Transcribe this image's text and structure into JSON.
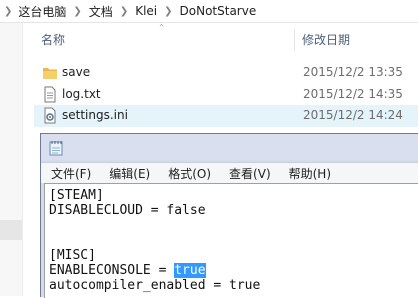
{
  "breadcrumb": {
    "items": [
      "这台电脑",
      "文档",
      "Klei",
      "DoNotStarve"
    ]
  },
  "columns": {
    "name": "名称",
    "date_modified": "修改日期"
  },
  "files": [
    {
      "name": "save",
      "date": "2015/12/2 13:35",
      "icon": "folder-icon"
    },
    {
      "name": "log.txt",
      "date": "2015/12/2 14:35",
      "icon": "text-file-icon"
    },
    {
      "name": "settings.ini",
      "date": "2015/12/2 14:24",
      "icon": "settings-file-icon",
      "selected": true
    }
  ],
  "notepad": {
    "menu": [
      "文件(F)",
      "编辑(E)",
      "格式(O)",
      "查看(V)",
      "帮助(H)"
    ],
    "lines": [
      "[STEAM]",
      "DISABLECLOUD = false",
      "",
      "",
      "[MISC]",
      "ENABLECONSOLE = ",
      "autocompiler_enabled = true"
    ],
    "selected_text": "true"
  },
  "colors": {
    "selection": "#3399ff",
    "row_selected": "#e5f3fb",
    "window_frame": "#d6dbe9"
  }
}
